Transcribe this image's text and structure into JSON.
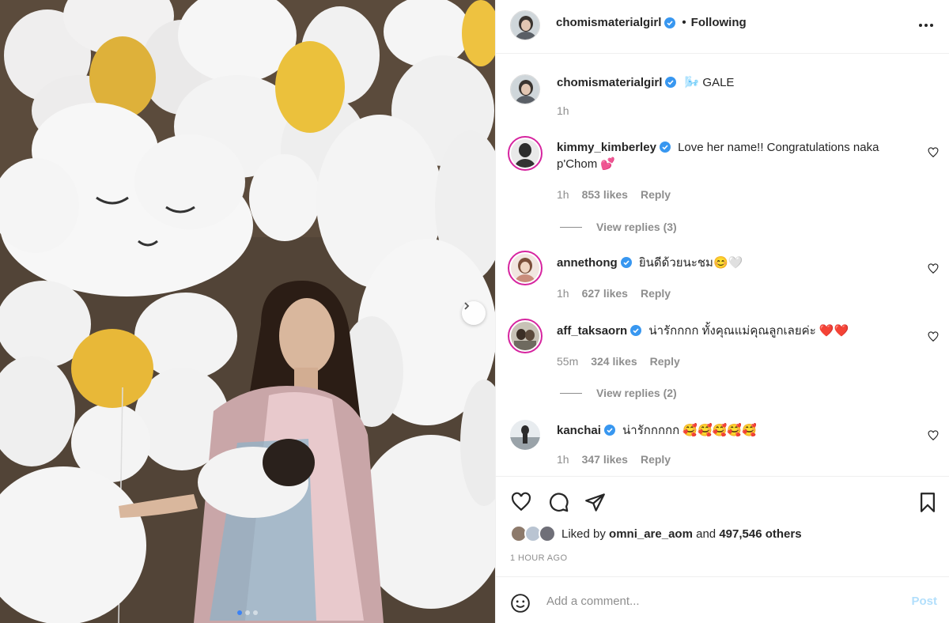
{
  "post": {
    "author": "chomismaterialgirl",
    "follow_separator": "•",
    "follow_status": "Following",
    "more_icon": "more-horizontal-icon"
  },
  "caption": {
    "username": "chomismaterialgirl",
    "text": "🌬️ GALE",
    "time": "1h"
  },
  "comments": [
    {
      "username": "kimmy_kimberley",
      "text": "Love her name!! Congratulations naka p'Chom 💕",
      "time": "1h",
      "likes": "853 likes",
      "reply": "Reply",
      "view_replies": "View replies (3)"
    },
    {
      "username": "annethong",
      "text": "ยินดีด้วยนะชม😊🤍",
      "time": "1h",
      "likes": "627 likes",
      "reply": "Reply",
      "view_replies": ""
    },
    {
      "username": "aff_taksaorn",
      "text": "น่ารักกกก ทั้งคุณแม่คุณลูกเลยค่ะ ❤️❤️",
      "time": "55m",
      "likes": "324 likes",
      "reply": "Reply",
      "view_replies": "View replies (2)"
    },
    {
      "username": "kanchai",
      "text": "น่ารักกกกก 🥰🥰🥰🥰🥰",
      "time": "1h",
      "likes": "347 likes",
      "reply": "Reply",
      "view_replies": ""
    }
  ],
  "likes": {
    "prefix": "Liked by ",
    "user": "omni_are_aom",
    "middle": " and ",
    "count": "497,546 others"
  },
  "timestamp": "1 HOUR AGO",
  "comment_box": {
    "placeholder": "Add a comment...",
    "post_label": "Post"
  },
  "carousel": {
    "current": 1,
    "total": 3
  },
  "colors": {
    "verified": "#3897f0",
    "muted": "#8e8e8e",
    "text": "#262626",
    "post_disabled": "#b2dffc"
  }
}
